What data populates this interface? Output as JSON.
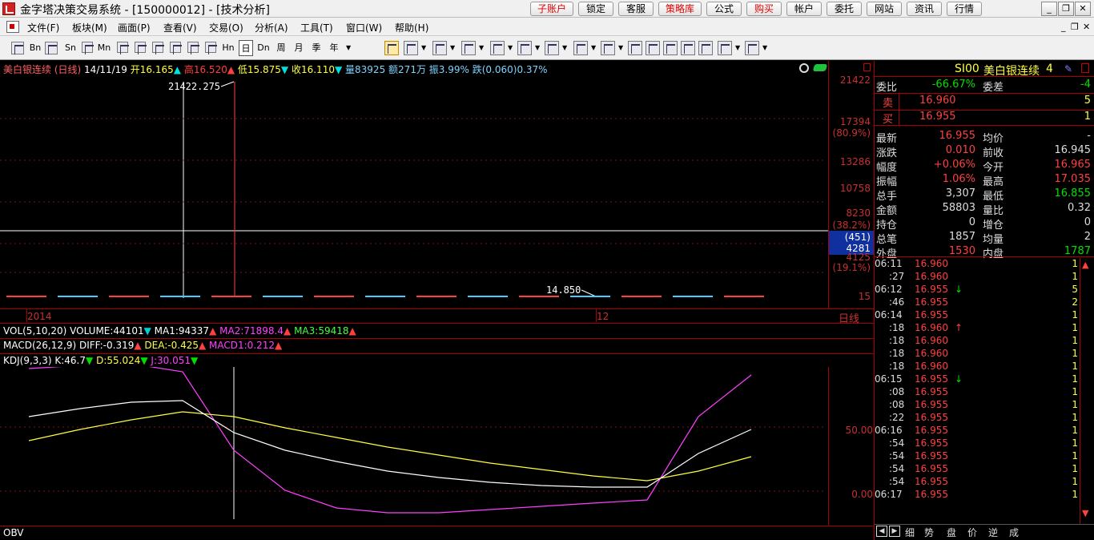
{
  "titlebar": {
    "title": "金字塔决策交易系统 - [150000012] - [技术分析]",
    "buttons": [
      {
        "label": "子账户",
        "red": true
      },
      {
        "label": "锁定",
        "red": false
      },
      {
        "label": "客服",
        "red": false
      },
      {
        "label": "策略库",
        "red": true
      },
      {
        "label": "公式",
        "red": false
      },
      {
        "label": "购买",
        "red": true
      },
      {
        "label": "帐户",
        "red": false
      },
      {
        "label": "委托",
        "red": false
      },
      {
        "label": "网站",
        "red": false
      },
      {
        "label": "资讯",
        "red": false
      },
      {
        "label": "行情",
        "red": false
      }
    ]
  },
  "menubar": {
    "items": [
      "文件(F)",
      "板块(M)",
      "画面(P)",
      "查看(V)",
      "交易(O)",
      "分析(A)",
      "工具(T)",
      "窗口(W)",
      "帮助(H)"
    ]
  },
  "toolbar": {
    "periods": [
      "Bn",
      "Sn",
      "Mn",
      "Hn",
      "日",
      "Dn",
      "周",
      "月",
      "季",
      "年"
    ],
    "selected_period": "日"
  },
  "chart": {
    "header": {
      "name": "美白银连续",
      "period": "(日线)",
      "date": "14/11/19",
      "open": "开16.165",
      "high": "高16.520",
      "low": "低15.875",
      "close": "收16.110",
      "volume": "量83925",
      "amount": "额271万",
      "amplitude": "振3.99%",
      "change": "跌(0.060)0.37%"
    },
    "annotations": {
      "high_mark": "21422.275",
      "low_mark": "14.850"
    },
    "right_axis": [
      "21422",
      "17394",
      "(80.9%)",
      "13286",
      "10758",
      "8230",
      "(38.2%)",
      "(451)",
      "4281",
      "4125",
      "(19.1%)",
      "15"
    ],
    "x_axis": {
      "left": "2014",
      "mid": "12",
      "right": "日线"
    },
    "vol_line": {
      "name": "VOL(5,10,20)",
      "volume": "VOLUME:44101",
      "ma1": "MA1:94337",
      "ma2": "MA2:71898.4",
      "ma3": "MA3:59418"
    },
    "macd_line": {
      "name": "MACD(26,12,9)",
      "diff": "DIFF:-0.319",
      "dea": "DEA:-0.425",
      "macd": "MACD1:0.212"
    },
    "kdj_line": {
      "name": "KDJ(9,3,3)",
      "k": "K:46.7",
      "d": "D:55.024",
      "j": "J:30.051"
    },
    "kdj_axis": [
      "50.00",
      "0.00"
    ],
    "obv_label": "OBV",
    "colors": {
      "k": "#ffffff",
      "d": "#ffff40",
      "j": "#ff40ff",
      "frame": "#aa0000"
    }
  },
  "quote": {
    "symbol": "SI00",
    "name": "美白银连续",
    "number": "4",
    "weibi_label": "委比",
    "weibi": "-66.67%",
    "weicha_label": "委差",
    "weicha": "-4",
    "sell_label": "卖",
    "sell_price": "16.960",
    "sell_vol": "5",
    "buy_label": "买",
    "buy_price": "16.955",
    "buy_vol": "1",
    "stats": [
      {
        "l1": "最新",
        "v1": "16.955",
        "c1": "red",
        "l2": "均价",
        "v2": "-",
        "c2": "white"
      },
      {
        "l1": "涨跌",
        "v1": "0.010",
        "c1": "red",
        "l2": "前收",
        "v2": "16.945",
        "c2": "white"
      },
      {
        "l1": "幅度",
        "v1": "+0.06%",
        "c1": "red",
        "l2": "今开",
        "v2": "16.965",
        "c2": "red"
      },
      {
        "l1": "振幅",
        "v1": "1.06%",
        "c1": "red",
        "l2": "最高",
        "v2": "17.035",
        "c2": "red"
      },
      {
        "l1": "总手",
        "v1": "3,307",
        "c1": "white",
        "l2": "最低",
        "v2": "16.855",
        "c2": "green"
      },
      {
        "l1": "金额",
        "v1": "58803",
        "c1": "white",
        "l2": "量比",
        "v2": "0.32",
        "c2": "white"
      },
      {
        "l1": "持仓",
        "v1": "0",
        "c1": "white",
        "l2": "增仓",
        "v2": "0",
        "c2": "white"
      },
      {
        "l1": "总笔",
        "v1": "1857",
        "c1": "white",
        "l2": "均量",
        "v2": "2",
        "c2": "white"
      },
      {
        "l1": "外盘",
        "v1": "1530",
        "c1": "red",
        "l2": "内盘",
        "v2": "1787",
        "c2": "green"
      }
    ],
    "ticks": [
      {
        "time": "06:11",
        "price": "16.960",
        "arrow": "",
        "vol": "1"
      },
      {
        "time": ":27",
        "price": "16.960",
        "arrow": "",
        "vol": "1"
      },
      {
        "time": "06:12",
        "price": "16.955",
        "arrow": "down",
        "vol": "5"
      },
      {
        "time": ":46",
        "price": "16.955",
        "arrow": "",
        "vol": "2"
      },
      {
        "time": "06:14",
        "price": "16.955",
        "arrow": "",
        "vol": "1"
      },
      {
        "time": ":18",
        "price": "16.960",
        "arrow": "up",
        "vol": "1"
      },
      {
        "time": ":18",
        "price": "16.960",
        "arrow": "",
        "vol": "1"
      },
      {
        "time": ":18",
        "price": "16.960",
        "arrow": "",
        "vol": "1"
      },
      {
        "time": ":18",
        "price": "16.960",
        "arrow": "",
        "vol": "1"
      },
      {
        "time": "06:15",
        "price": "16.955",
        "arrow": "down",
        "vol": "1"
      },
      {
        "time": ":08",
        "price": "16.955",
        "arrow": "",
        "vol": "1"
      },
      {
        "time": ":08",
        "price": "16.955",
        "arrow": "",
        "vol": "1"
      },
      {
        "time": ":22",
        "price": "16.955",
        "arrow": "",
        "vol": "1"
      },
      {
        "time": "06:16",
        "price": "16.955",
        "arrow": "",
        "vol": "1"
      },
      {
        "time": ":54",
        "price": "16.955",
        "arrow": "",
        "vol": "1"
      },
      {
        "time": ":54",
        "price": "16.955",
        "arrow": "",
        "vol": "1"
      },
      {
        "time": ":54",
        "price": "16.955",
        "arrow": "",
        "vol": "1"
      },
      {
        "time": ":54",
        "price": "16.955",
        "arrow": "",
        "vol": "1"
      },
      {
        "time": "06:17",
        "price": "16.955",
        "arrow": "",
        "vol": "1"
      }
    ],
    "tabs": [
      "细",
      "势",
      "盘",
      "价",
      "逆",
      "成"
    ]
  }
}
